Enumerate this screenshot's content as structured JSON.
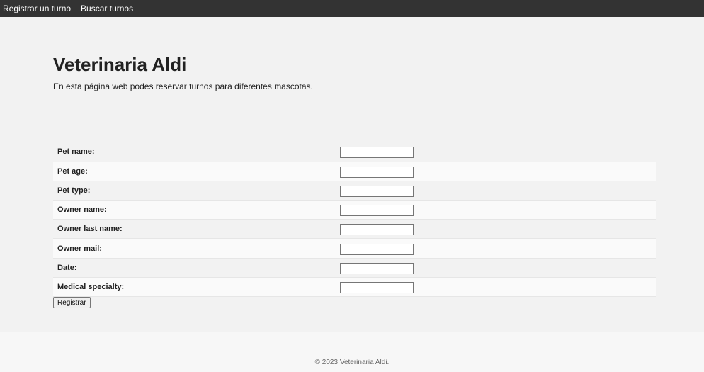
{
  "nav": {
    "items": [
      {
        "label": "Registrar un turno"
      },
      {
        "label": "Buscar turnos"
      }
    ]
  },
  "page": {
    "title": "Veterinaria Aldi",
    "subtitle": "En esta página web podes reservar turnos para diferentes mascotas."
  },
  "form": {
    "fields": [
      {
        "label": "Pet name:",
        "value": ""
      },
      {
        "label": "Pet age:",
        "value": ""
      },
      {
        "label": "Pet type:",
        "value": ""
      },
      {
        "label": "Owner name:",
        "value": ""
      },
      {
        "label": "Owner last name:",
        "value": ""
      },
      {
        "label": "Owner mail:",
        "value": ""
      },
      {
        "label": "Date:",
        "value": ""
      },
      {
        "label": "Medical specialty:",
        "value": ""
      }
    ],
    "submit_label": "Registrar"
  },
  "footer": {
    "text": "© 2023 Veterinaria Aldi."
  },
  "colors": {
    "nav_bg": "#333333",
    "nav_text": "#ffffff",
    "page_bg": "#f2f2f2"
  }
}
